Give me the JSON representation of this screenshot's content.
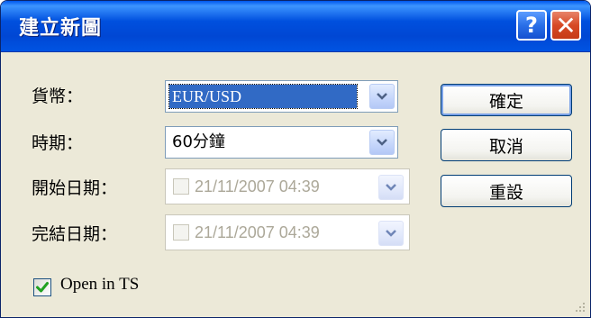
{
  "dialog": {
    "title": "建立新圖",
    "help_button": "?",
    "close_button": "✕"
  },
  "form": {
    "currency_label": "貨幣：",
    "currency_value": "EUR/USD",
    "period_label": "時期：",
    "period_value": "60分鐘",
    "start_label": "開始日期：",
    "start_value": "21/11/2007 04:39",
    "start_checked": false,
    "end_label": "完結日期：",
    "end_value": "21/11/2007 04:39",
    "end_checked": false,
    "open_in_ts_label": "Open in TS",
    "open_in_ts_checked": true
  },
  "buttons": {
    "ok": "確定",
    "cancel": "取消",
    "reset": "重設"
  },
  "icons": {
    "help": "question-icon",
    "close": "close-icon",
    "dropdown": "chevron-down-icon",
    "check": "check-icon",
    "grip": "resize-grip-icon"
  },
  "colors": {
    "titlebar": "#0054E3",
    "dialog_bg": "#ECE9D8",
    "selection": "#316AC5",
    "disabled_text": "#ACA899",
    "close_red": "#D74A26",
    "check_green": "#21A121"
  }
}
